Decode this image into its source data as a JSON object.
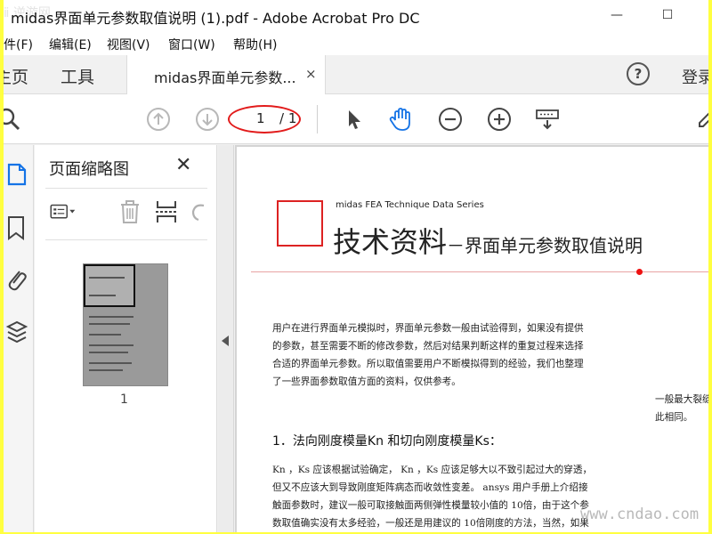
{
  "window": {
    "title": "midas界面单元参数取值说明 (1).pdf - Adobe Acrobat Pro DC",
    "minimize_glyph": "—",
    "maximize_glyph": "☐"
  },
  "menu": {
    "items": [
      "件(F)",
      "编辑(E)",
      "视图(V)",
      "窗口(W)",
      "帮助(H)"
    ]
  },
  "tabs": {
    "home": "主页",
    "tools": "工具",
    "document": "midas界面单元参数...",
    "close_glyph": "×",
    "help": "?",
    "login": "登录"
  },
  "toolbar": {
    "current_page": "1",
    "total_pages": "/ 1"
  },
  "thumbnails": {
    "title": "页面缩略图",
    "close_glyph": "✕",
    "page_label": "1"
  },
  "document": {
    "series": "midas FEA   Technique Data Series",
    "heading_main": "技术资料",
    "heading_sub": "－界面单元参数取值说明",
    "paragraph": [
      "用户在进行界面单元模拟时，界面单元参数一般由试验得到，如果没有提供",
      "的参数，甚至需要不断的修改参数，然后对结果判断这样的重复过程来选择",
      "合适的界面单元参数。所以取值需要用户不断模拟得到的经验，我们也整理",
      "了一些界面参数取值方面的资料，仅供参考。"
    ],
    "side_note": [
      "一般最大裂缝",
      "此相同。"
    ],
    "section_heading": "1．法向刚度模量Kn 和切向刚度模量Ks：",
    "section_body": [
      "Kn ，Ks 应该根据试验确定，     Kn ，Ks  应该足够大以不致引起过大的穿透，",
      "但又不应该大到导致刚度矩阵病态而收敛性变差。           ansys 用户手册上介绍接",
      "触面参数时，建议一般可取接触面两侧弹性模量较小值的          10倍，由于这个参",
      "数取值确实没有太多经验，一般还是用建议的        10倍刚度的方法，当然，如果"
    ]
  },
  "watermarks": {
    "left": "ⅱ 逆游网",
    "right": "www.cndao.com"
  },
  "colors": {
    "accent_red": "#e21b1b",
    "hand_tool_blue": "#1473e6",
    "title_bar": "#ffffff",
    "outer_border": "#ffff40"
  },
  "icons": [
    "search-icon",
    "prev-page-icon",
    "next-page-icon",
    "select-cursor-icon",
    "hand-tool-icon",
    "zoom-out-icon",
    "zoom-in-icon",
    "keyboard-icon",
    "thumbnails-icon",
    "bookmark-icon",
    "attachment-icon",
    "layers-icon",
    "page-options-icon",
    "delete-icon",
    "insert-page-icon",
    "rotate-icon"
  ]
}
